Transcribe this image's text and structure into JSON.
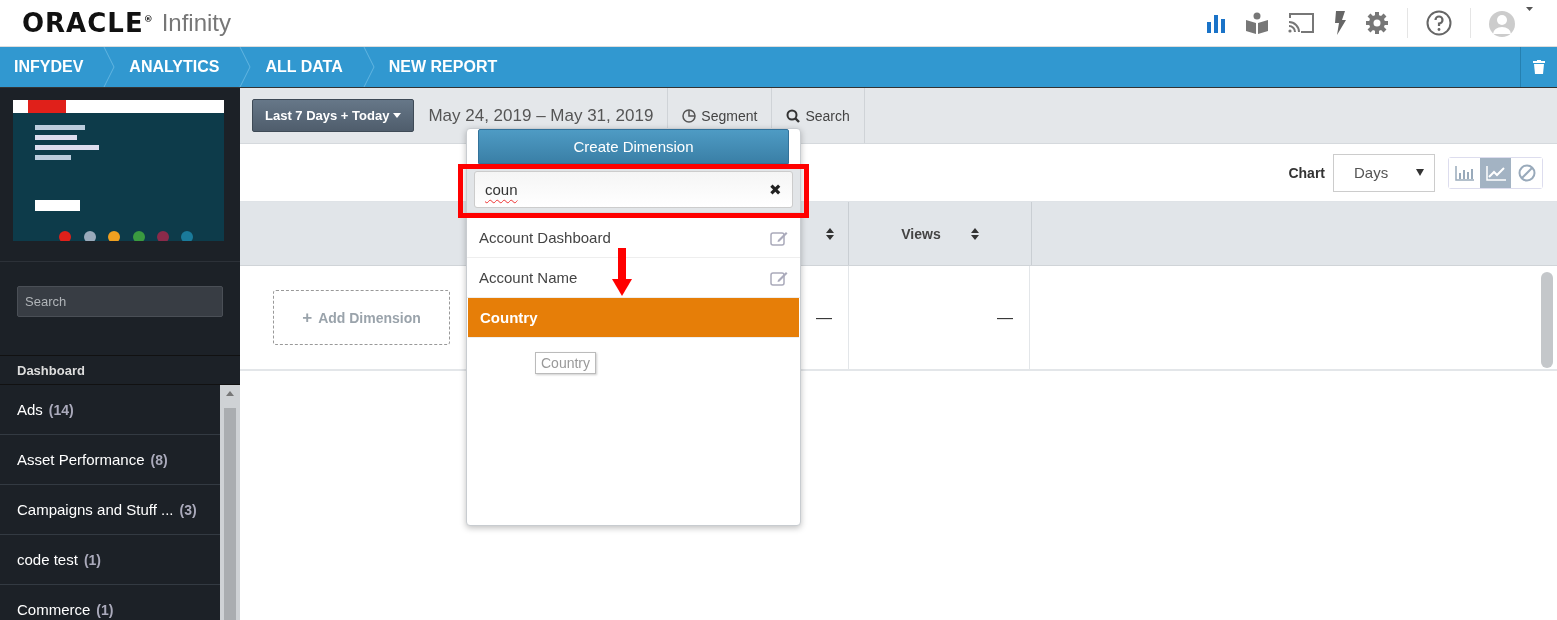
{
  "header": {
    "logo": "ORACLE$^{®}$",
    "product": "Infinity"
  },
  "breadcrumbs": [
    "INFYDEV",
    "ANALYTICS",
    "ALL DATA",
    "NEW REPORT"
  ],
  "sidebar": {
    "search": {
      "placeholder": "Search"
    },
    "section": "Dashboard",
    "items": [
      {
        "label": "Ads",
        "count": "(14)"
      },
      {
        "label": "Asset Performance",
        "count": "(8)"
      },
      {
        "label": "Campaigns and Stuff ...",
        "count": "(3)"
      },
      {
        "label": "code test",
        "count": "(1)"
      },
      {
        "label": "Commerce",
        "count": "(1)"
      }
    ]
  },
  "toolbar": {
    "range_button": "Last 7 Days + Today",
    "date_range": "May 24, 2019 – May 31, 2019",
    "segment": "Segment",
    "search": "Search"
  },
  "chart_controls": {
    "label": "Chart",
    "interval": "Days",
    "types": [
      {
        "kind": "bar",
        "selected": false
      },
      {
        "kind": "line",
        "selected": true
      },
      {
        "kind": "none",
        "selected": false
      }
    ]
  },
  "table": {
    "columns": [
      {
        "sortable": true
      },
      {
        "label": "Views",
        "sortable": true
      }
    ],
    "row": {
      "cells": [
        "—",
        "—"
      ]
    }
  },
  "add_dimension": {
    "icon": "+",
    "label": "Add Dimension"
  },
  "dimension_menu": {
    "create_button": "Create Dimension",
    "search": {
      "value": "coun",
      "clear": "✖"
    },
    "items": [
      {
        "label": "Account Dashboard",
        "editable": true,
        "selected": false
      },
      {
        "label": "Account Name",
        "editable": true,
        "selected": false
      },
      {
        "label": "Country",
        "editable": false,
        "selected": true
      }
    ],
    "tooltip": "Country"
  }
}
